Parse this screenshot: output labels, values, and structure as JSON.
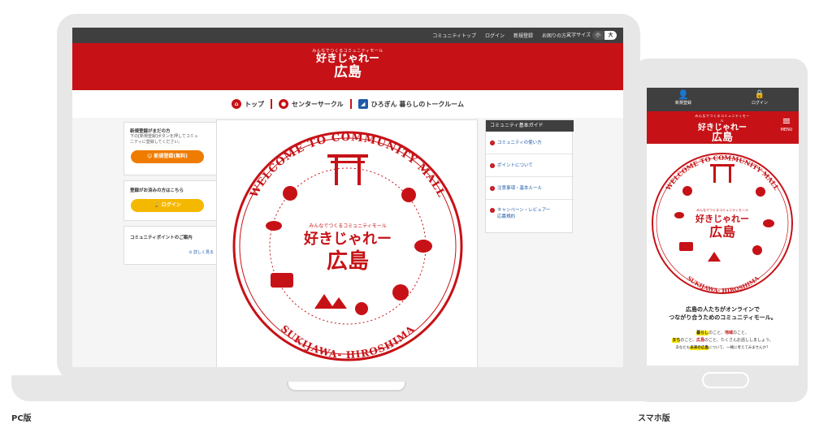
{
  "pc": {
    "topbar": {
      "links": [
        "コミュニティトップ",
        "ログイン",
        "新規登録",
        "お困りの方へ"
      ],
      "font_size_label": "文字サイズ",
      "font_small": "小",
      "font_large": "大"
    },
    "logo": {
      "tagline": "みんなでつくるコミュニティモール",
      "line1": "好きじゃれー",
      "line2": "広島"
    },
    "nav": {
      "top": "トップ",
      "center_circle": "センターサークル",
      "hirogin": "ひろぎん 暮らしのトークルーム"
    },
    "sidebar": {
      "new_title": "新規登録がまだの方",
      "new_text1": "下の[新規登録]ボタンを押してコミュ",
      "new_text2": "ニティに登録してください。",
      "register_button": "新規登録(無料)",
      "login_title": "登録がお済みの方はこちら",
      "login_button": "ログイン",
      "points_title": "コミュニティポイントのご案内",
      "points_link": "詳しく見る"
    },
    "emblem": {
      "top_text": "WELCOME TO COMMUNITY MALL",
      "bottom_text": "SUKIJAWA- HIROSHIMA",
      "tagline": "みんなでつくるコミュニティモール",
      "line1": "好きじゃれー",
      "line2": "広島"
    },
    "guide": {
      "title": "コミュニティ基本ガイド",
      "items": [
        "コミュニティの使い方",
        "ポイントについて",
        "注意事項・基本ルール",
        "キャンペーン・レビュアー",
        "応募規約"
      ]
    }
  },
  "phone": {
    "register_label": "新規登録",
    "login_label": "ログイン",
    "menu_label": "MENU",
    "logo": {
      "tagline": "みんなでつくるコミュニティモール",
      "line1": "好きじゃれー",
      "line2": "広島"
    },
    "emblem": {
      "top_text": "WELCOME TO COMMUNITY MALL",
      "bottom_text": "SUKIJAWA- HIROSHIMA",
      "tagline": "みんなでつくるコミュニティモール",
      "line1": "好きじゃれー",
      "line2": "広島"
    },
    "headline1": "広島の人たちがオンラインで",
    "headline2": "つながり合うためのコミュニティモール。",
    "sub1_a": "暮らし",
    "sub1_b": "のこと、",
    "sub1_c": "地域",
    "sub1_d": "のこと、",
    "sub2_a": "まち",
    "sub2_b": "のこと、",
    "sub2_c": "広島",
    "sub2_d": "のこと、たくさんお話ししましょう。",
    "sub3_a": "あなたも",
    "sub3_b": "未来の広島",
    "sub3_c": "について、一緒に考えてみませんか？"
  },
  "labels": {
    "pc": "PC版",
    "sp": "スマホ版"
  },
  "colors": {
    "brand_red": "#c61217",
    "orange": "#ef7c00",
    "yellow": "#f5b800",
    "dark_bar": "#3f3f3f",
    "link_blue": "#1e5aa8"
  }
}
